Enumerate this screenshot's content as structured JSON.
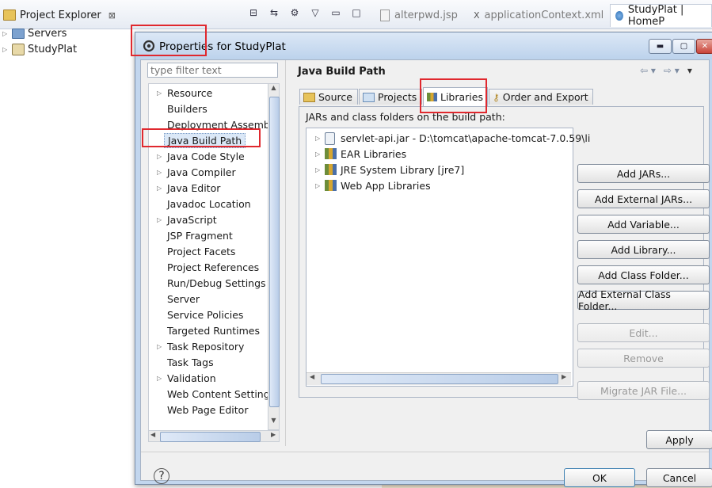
{
  "explorer": {
    "tab_label": "Project Explorer",
    "tab_close": "⊠",
    "tree": [
      {
        "label": "Servers",
        "icon": "folder-icon"
      },
      {
        "label": "StudyPlat",
        "icon": "project-icon"
      }
    ]
  },
  "editor_tabs": [
    {
      "label": "alterpwd.jsp"
    },
    {
      "label": "applicationContext.xml"
    },
    {
      "label": "StudyPlat | HomeP"
    }
  ],
  "dialog": {
    "title": "Properties for StudyPlat",
    "filter_placeholder": "type filter text",
    "nav_items": [
      {
        "label": "Resource",
        "expandable": true
      },
      {
        "label": "Builders",
        "expandable": false
      },
      {
        "label": "Deployment Assembly",
        "expandable": false
      },
      {
        "label": "Java Build Path",
        "expandable": false,
        "selected": true
      },
      {
        "label": "Java Code Style",
        "expandable": true
      },
      {
        "label": "Java Compiler",
        "expandable": true
      },
      {
        "label": "Java Editor",
        "expandable": true
      },
      {
        "label": "Javadoc Location",
        "expandable": false
      },
      {
        "label": "JavaScript",
        "expandable": true
      },
      {
        "label": "JSP Fragment",
        "expandable": false
      },
      {
        "label": "Project Facets",
        "expandable": false
      },
      {
        "label": "Project References",
        "expandable": false
      },
      {
        "label": "Run/Debug Settings",
        "expandable": false
      },
      {
        "label": "Server",
        "expandable": false
      },
      {
        "label": "Service Policies",
        "expandable": false
      },
      {
        "label": "Targeted Runtimes",
        "expandable": false
      },
      {
        "label": "Task Repository",
        "expandable": true
      },
      {
        "label": "Task Tags",
        "expandable": false
      },
      {
        "label": "Validation",
        "expandable": true
      },
      {
        "label": "Web Content Settings",
        "expandable": false
      },
      {
        "label": "Web Page Editor",
        "expandable": false
      }
    ],
    "page_title": "Java Build Path",
    "tabs": [
      {
        "label": "Source"
      },
      {
        "label": "Projects"
      },
      {
        "label": "Libraries",
        "active": true
      },
      {
        "label": "Order and Export"
      }
    ],
    "panel_caption": "JARs and class folders on the build path:",
    "libraries": [
      {
        "label": "servlet-api.jar - D:\\tomcat\\apache-tomcat-7.0.59\\li",
        "icon": "jar-icon"
      },
      {
        "label": "EAR Libraries",
        "icon": "library-icon"
      },
      {
        "label": "JRE System Library [jre7]",
        "icon": "library-icon"
      },
      {
        "label": "Web App Libraries",
        "icon": "library-icon"
      }
    ],
    "buttons": [
      {
        "label": "Add JARs...",
        "enabled": true
      },
      {
        "label": "Add External JARs...",
        "enabled": true
      },
      {
        "label": "Add Variable...",
        "enabled": true
      },
      {
        "label": "Add Library...",
        "enabled": true
      },
      {
        "label": "Add Class Folder...",
        "enabled": true
      },
      {
        "label": "Add External Class Folder...",
        "enabled": true
      },
      {
        "label": "Edit...",
        "enabled": false
      },
      {
        "label": "Remove",
        "enabled": false
      },
      {
        "label": "Migrate JAR File...",
        "enabled": false
      }
    ],
    "apply_label": "Apply",
    "ok_label": "OK",
    "cancel_label": "Cancel",
    "help_glyph": "?"
  },
  "colors": {
    "highlight_box": "#e0282e",
    "selection": "#3399ff"
  }
}
